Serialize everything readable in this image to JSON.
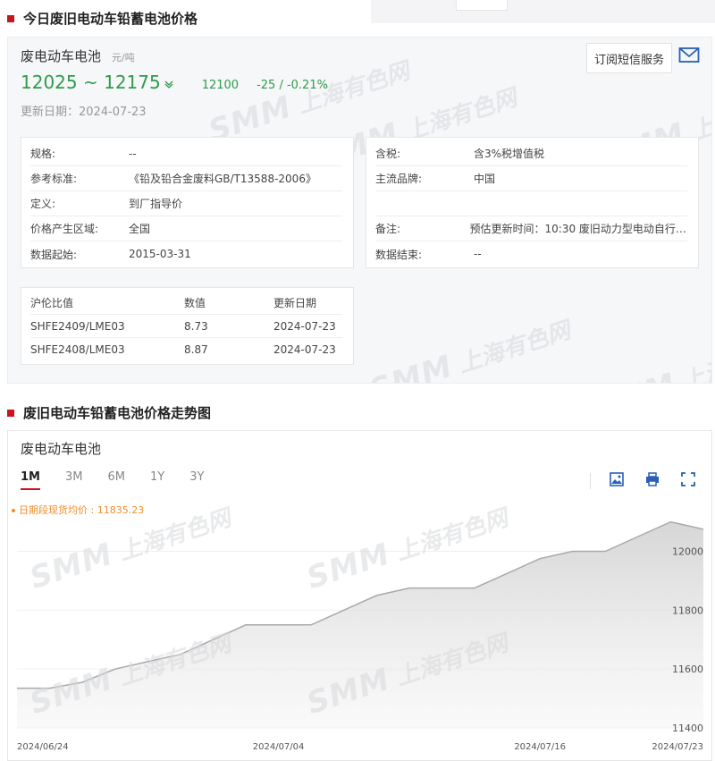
{
  "section1": {
    "title": "今日废旧电动车铅蓄电池价格"
  },
  "product": {
    "name": "废电动车电池",
    "unit": "元/吨",
    "price_range": "12025 ~ 12175",
    "avg": "12100",
    "change": "-25 / -0.21%",
    "update_date": "更新日期：2024-07-23",
    "subscribe_label": "订阅短信服务"
  },
  "watermark": {
    "brand": "SMM",
    "cn": "上海有色网"
  },
  "info_left": [
    {
      "k": "规格:",
      "v": "--"
    },
    {
      "k": "参考标准:",
      "v": "《铅及铅合金废料GB/T13588-2006》"
    },
    {
      "k": "定义:",
      "v": "到厂指导价"
    },
    {
      "k": "价格产生区域:",
      "v": "全国"
    },
    {
      "k": "数据起始:",
      "v": "2015-03-31"
    }
  ],
  "info_right": [
    {
      "k": "含税:",
      "v": "含3%税增值税"
    },
    {
      "k": "主流品牌:",
      "v": "中国"
    },
    {
      "k": "",
      "v": ""
    },
    {
      "k": "备注:",
      "v": "预估更新时间：10:30 废旧动力型电动自行车..."
    },
    {
      "k": "数据结束:",
      "v": "--"
    }
  ],
  "ratio_table": {
    "headers": [
      "沪伦比值",
      "数值",
      "更新日期"
    ],
    "rows": [
      [
        "SHFE2409/LME03",
        "8.73",
        "2024-07-23"
      ],
      [
        "SHFE2408/LME03",
        "8.87",
        "2024-07-23"
      ]
    ]
  },
  "section2": {
    "title": "废旧电动车铅蓄电池价格走势图"
  },
  "chart_panel": {
    "name": "废电动车电池",
    "tabs": [
      "1M",
      "3M",
      "6M",
      "1Y",
      "3Y"
    ],
    "active_tab": "1M",
    "avg_note": "日期段现货均价 : 11835.23"
  },
  "colors": {
    "accent": "#c8161d",
    "up_down": "#2f9b4a",
    "note": "#f08c2e"
  },
  "chart_data": {
    "type": "area",
    "x": [
      "2024-06-24",
      "2024-06-25",
      "2024-06-26",
      "2024-06-27",
      "2024-06-28",
      "2024-07-01",
      "2024-07-02",
      "2024-07-03",
      "2024-07-04",
      "2024-07-05",
      "2024-07-08",
      "2024-07-09",
      "2024-07-10",
      "2024-07-11",
      "2024-07-12",
      "2024-07-15",
      "2024-07-16",
      "2024-07-17",
      "2024-07-18",
      "2024-07-19",
      "2024-07-22",
      "2024-07-23"
    ],
    "values": [
      11535,
      11535,
      11555,
      11600,
      11625,
      11650,
      11700,
      11750,
      11750,
      11750,
      11800,
      11850,
      11875,
      11875,
      11875,
      11925,
      11975,
      12000,
      12000,
      12050,
      12100,
      12075
    ],
    "x_tick_labels": [
      "2024/06/24",
      "2024/07/04",
      "2024/07/16",
      "2024/07/23"
    ],
    "x_tick_index": [
      0,
      8,
      16,
      21
    ],
    "y_ticks": [
      11400,
      11600,
      11800,
      12000
    ],
    "ylim": [
      11400,
      12120
    ],
    "title": "",
    "xlabel": "",
    "ylabel": ""
  }
}
